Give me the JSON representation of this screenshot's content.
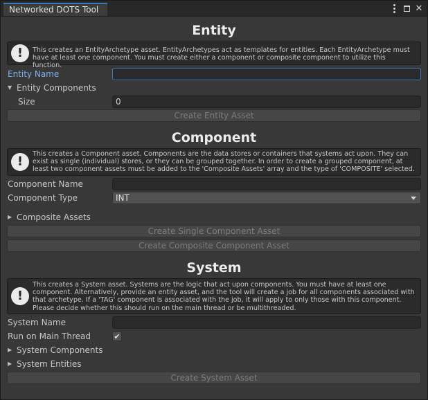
{
  "window": {
    "tab_title": "Networked DOTS Tool",
    "menu_icon": "kebab-menu-icon",
    "maximize_icon": "maximize-icon",
    "close_icon": "close-icon",
    "close_glyph": "✕"
  },
  "colors": {
    "focus_accent": "#3a79bb",
    "focus_label": "#7bb1ec",
    "panel_bg": "#383838"
  },
  "entity": {
    "heading": "Entity",
    "help_icon": "warning-icon",
    "help_glyph": "!",
    "help_text": "This creates an EntityArchetype asset. EntityArchetypes act as templates for entities. Each EntityArchetype must have at least one component. You must create either a component or composite component to utilize this function.",
    "name_label": "Entity Name",
    "name_value": "",
    "components_label": "Entity Components",
    "components_expanded": true,
    "size_label": "Size",
    "size_value": "0",
    "create_button": "Create Entity Asset"
  },
  "component": {
    "heading": "Component",
    "help_icon": "warning-icon",
    "help_glyph": "!",
    "help_text": "This creates a Component asset. Components are the data stores or containers that systems act upon. They can exist as single (individual) stores, or they can be grouped together. In order to create a grouped component, at least two component assets must be added to the 'Composite Assets' array and the type of 'COMPOSITE' selected.",
    "name_label": "Component Name",
    "name_value": "",
    "type_label": "Component Type",
    "type_value": "INT",
    "composite_label": "Composite Assets",
    "composite_expanded": false,
    "single_button": "Create Single Component Asset",
    "composite_button": "Create Composite Component Asset"
  },
  "system": {
    "heading": "System",
    "help_icon": "warning-icon",
    "help_glyph": "!",
    "help_text": "This creates a System asset. Systems are the logic that act upon components. You must have at least one component. Alternatively, provide an entity asset, and the tool will create a job for all components associated with that archetype. If a 'TAG' component is associated with the job, it will apply to only those with this component. Please decide whether this should run on the main thread or be multithreaded.",
    "name_label": "System Name",
    "name_value": "",
    "main_thread_label": "Run on Main Thread",
    "main_thread_checked": true,
    "check_glyph": "✔",
    "components_label": "System Components",
    "entities_label": "System Entities",
    "create_button": "Create System Asset"
  },
  "arrows": {
    "expanded": "▼",
    "collapsed": "▶"
  }
}
